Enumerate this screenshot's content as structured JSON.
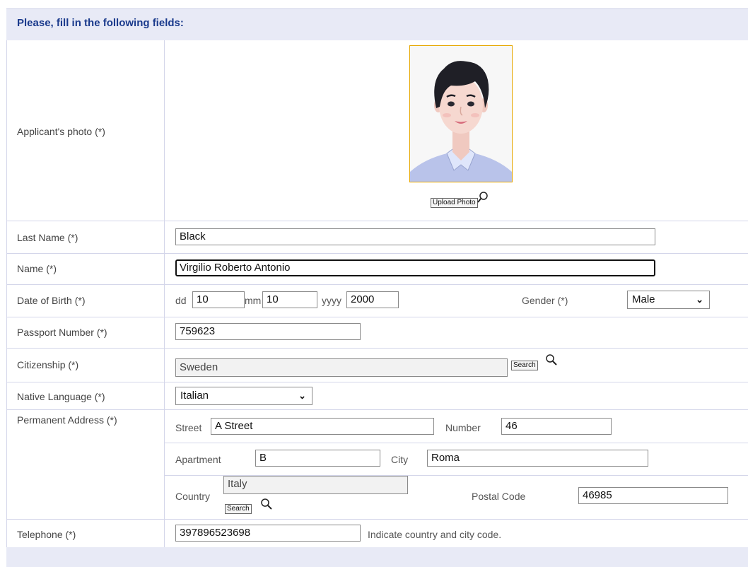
{
  "form": {
    "title": "Please, fill in the following fields:",
    "photo_label": "Applicant's photo (*)",
    "upload_button": "Upload Photo",
    "last_name_label": "Last Name (*)",
    "last_name_value": "Black",
    "name_label": "Name (*)",
    "name_value": "Virgilio Roberto Antonio",
    "dob_label": "Date of Birth (*)",
    "dob_dd_label": "dd",
    "dob_dd_value": "10",
    "dob_mm_label": "mm",
    "dob_mm_value": "10",
    "dob_yyyy_label": "yyyy",
    "dob_yyyy_value": "2000",
    "gender_label": "Gender (*)",
    "gender_value": "Male",
    "passport_label": "Passport Number (*)",
    "passport_value": "759623",
    "citizenship_label": "Citizenship (*)",
    "citizenship_value": "Sweden",
    "search_button": "Search",
    "language_label": "Native Language (*)",
    "language_value": "Italian",
    "address_label": "Permanent Address (*)",
    "street_label": "Street",
    "street_value": "A Street",
    "number_label": "Number",
    "number_value": "46",
    "apartment_label": "Apartment",
    "apartment_value": "B",
    "city_label": "City",
    "city_value": "Roma",
    "country_label": "Country",
    "country_value": "Italy",
    "postal_label": "Postal Code",
    "postal_value": "46985",
    "telephone_label": "Telephone (*)",
    "telephone_value": "397896523698",
    "telephone_hint": "Indicate country and city code."
  },
  "colors": {
    "header_bg": "#e8eaf6",
    "header_text": "#1a3a8c",
    "photo_border": "#e6a700",
    "grid_line": "#d4d6ea"
  },
  "icons": [
    "magnifier-icon",
    "chevron-down-icon"
  ]
}
